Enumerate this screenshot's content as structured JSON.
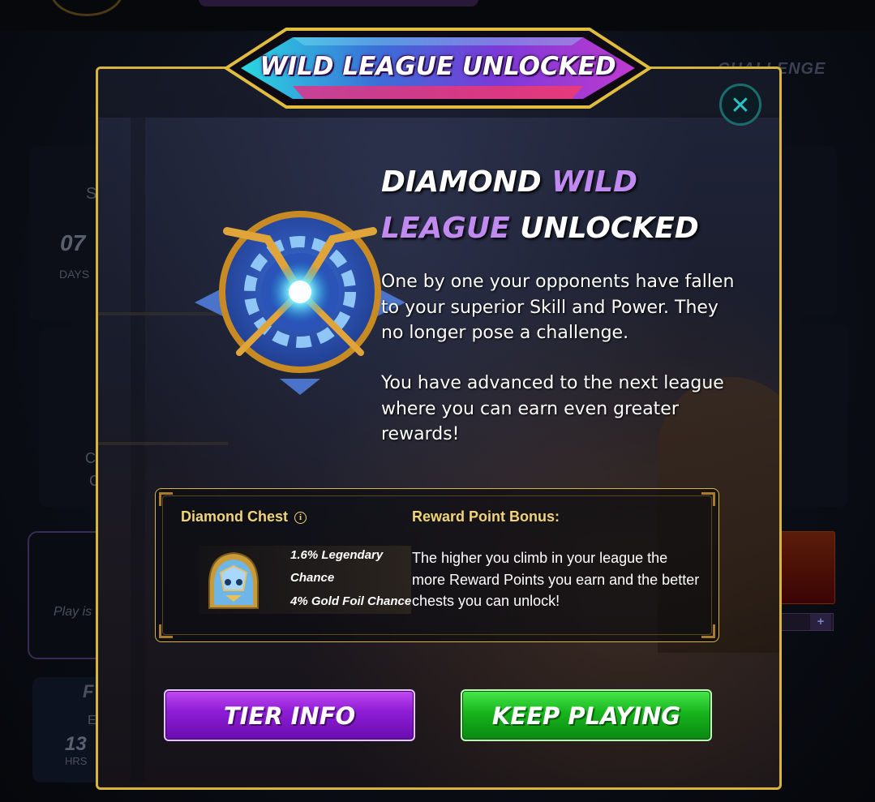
{
  "background": {
    "challenge_label": "CHALLENGE",
    "days_value": "07",
    "days_label": "DAYS",
    "hours_value": "13",
    "hours_label": "HRS",
    "play_text": "Play is",
    "stub_s": "S",
    "stub_c1": "C",
    "stub_c2": "C",
    "stub_f": "F",
    "stub_e": "E",
    "plus": "+"
  },
  "modal": {
    "banner_title": "WILD LEAGUE UNLOCKED",
    "close_symbol": "✕",
    "headline": {
      "part1": "DIAMOND ",
      "part2": "WILD",
      "part3": "LEAGUE",
      "part4": " UNLOCKED"
    },
    "paragraph1": "One by one your opponents have fallen to your superior Skill and Power. They no longer pose a challenge.",
    "paragraph2": "You have advanced to the next league where you can earn even greater rewards!",
    "reward": {
      "chest_title": "Diamond Chest",
      "info_symbol": "i",
      "legendary_line1": "1.6% Legendary",
      "legendary_line2": "Chance",
      "gold_foil": "4% Gold Foil Chance",
      "bonus_title": "Reward Point Bonus:",
      "bonus_text": "The higher you climb in your league the more Reward Points you earn and the better chests you can unlock!"
    },
    "buttons": {
      "tier_info": "TIER INFO",
      "keep_playing": "KEEP PLAYING"
    }
  },
  "colors": {
    "gold_border": "#d8b437",
    "accent_purple": "#c08af0",
    "tier_button": "#8f1ed6",
    "keep_button": "#17b51d",
    "close_teal": "#2bc3c4"
  },
  "icons": [
    "close-icon",
    "info-icon",
    "league-emblem-icon",
    "diamond-chest-icon"
  ]
}
